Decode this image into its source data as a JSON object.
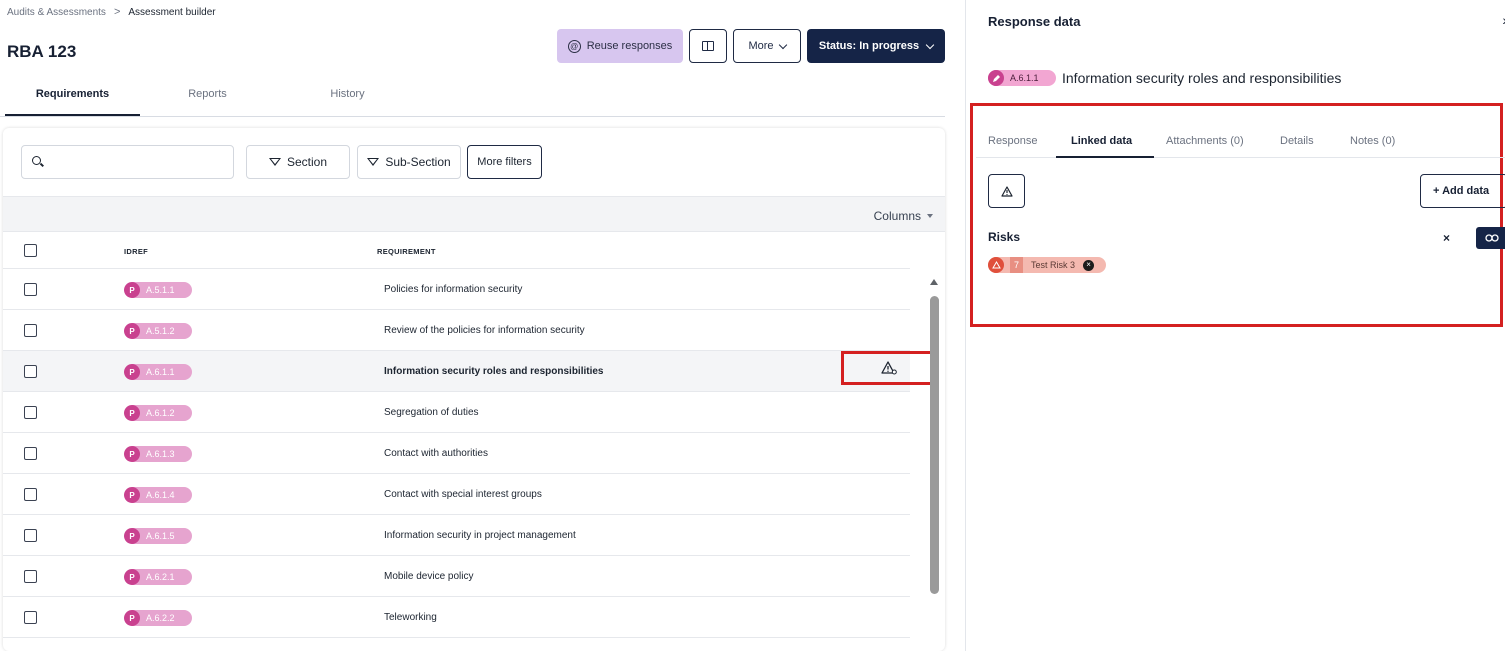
{
  "breadcrumb": {
    "parent": "Audits & Assessments",
    "separator": ">",
    "current": "Assessment builder"
  },
  "page": {
    "title": "RBA 123"
  },
  "actions": {
    "reuse_label": "Reuse responses",
    "more_label": "More",
    "status_label": "Status: In progress"
  },
  "tabs": {
    "requirements": "Requirements",
    "reports": "Reports",
    "history": "History"
  },
  "filters": {
    "search_placeholder": "",
    "section": "Section",
    "subsection": "Sub-Section",
    "more": "More filters"
  },
  "columns_label": "Columns",
  "table": {
    "headers": {
      "idref": "IDREF",
      "requirement": "REQUIREMENT"
    },
    "rows": [
      {
        "badge": "P",
        "idref": "A.5.1.1",
        "requirement": "Policies for information security"
      },
      {
        "badge": "P",
        "idref": "A.5.1.2",
        "requirement": "Review of the policies for information security"
      },
      {
        "badge": "P",
        "idref": "A.6.1.1",
        "requirement": "Information security roles and responsibilities"
      },
      {
        "badge": "P",
        "idref": "A.6.1.2",
        "requirement": "Segregation of duties"
      },
      {
        "badge": "P",
        "idref": "A.6.1.3",
        "requirement": "Contact with authorities"
      },
      {
        "badge": "P",
        "idref": "A.6.1.4",
        "requirement": "Contact with special interest groups"
      },
      {
        "badge": "P",
        "idref": "A.6.1.5",
        "requirement": "Information security in project management"
      },
      {
        "badge": "P",
        "idref": "A.6.2.1",
        "requirement": "Mobile device policy"
      },
      {
        "badge": "P",
        "idref": "A.6.2.2",
        "requirement": "Teleworking"
      }
    ]
  },
  "panel": {
    "title": "Response data",
    "close": "›",
    "item_ref": "A.6.1.1",
    "item_title": "Information security roles and responsibilities",
    "tabs": {
      "response": "Response",
      "linked": "Linked data",
      "attachments": "Attachments (0)",
      "details": "Details",
      "notes": "Notes (0)"
    },
    "add_label": "+ Add data",
    "risks_title": "Risks",
    "remove_label": "×",
    "risk": {
      "score": "7",
      "name": "Test Risk 3",
      "remove": "×"
    }
  },
  "colors": {
    "primary": "#152447",
    "accent_pink": "#c9418f",
    "reuse_bg": "#d7c6ef",
    "highlight_red": "#d42020",
    "risk_red": "#e0503c"
  }
}
